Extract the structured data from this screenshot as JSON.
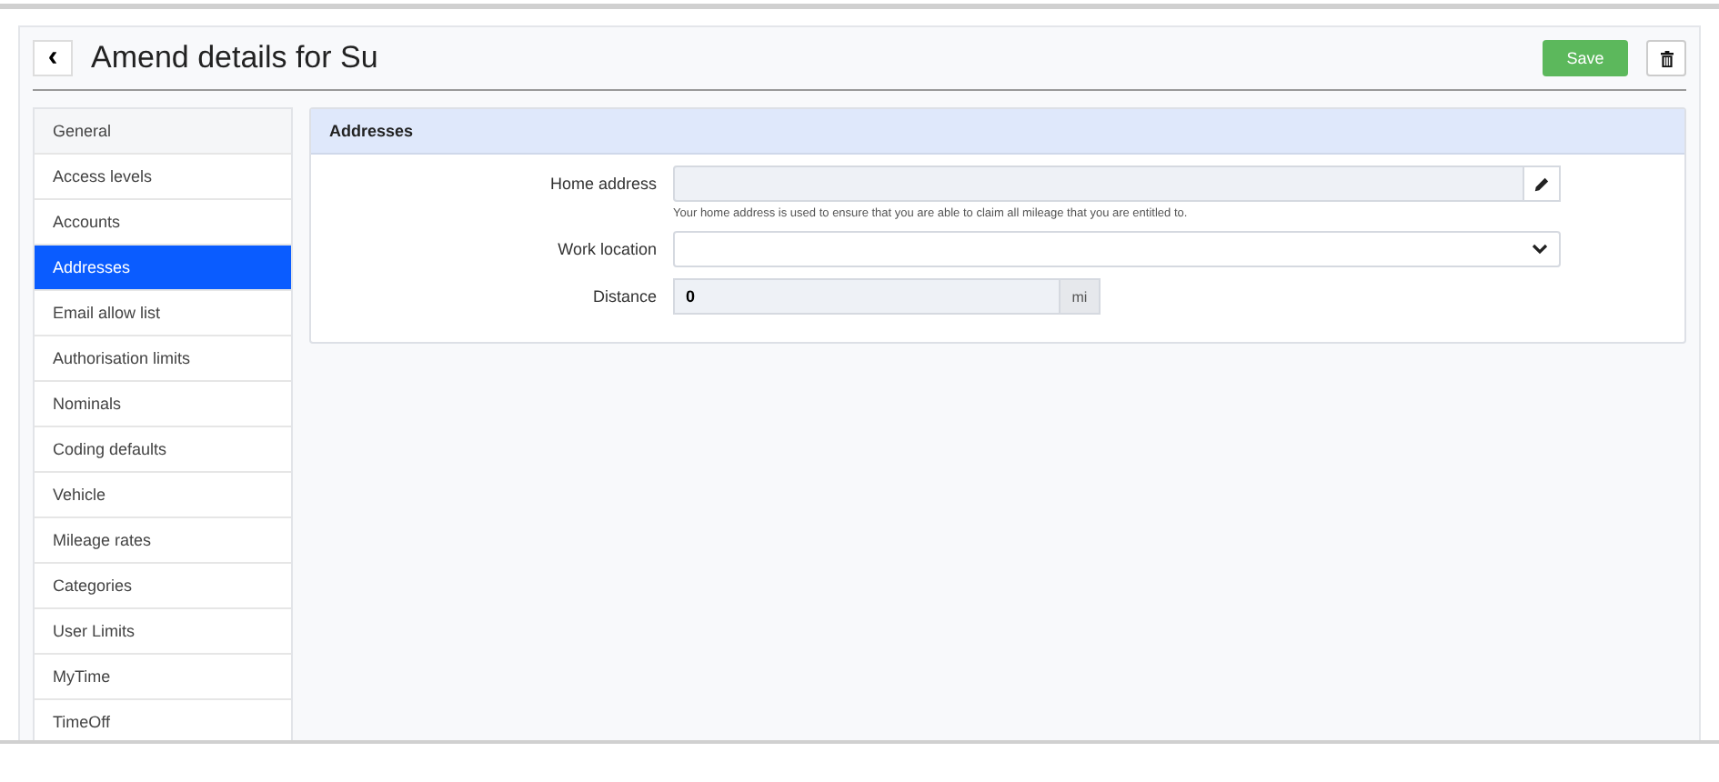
{
  "header": {
    "back_icon": "‹",
    "title": "Amend details for Su",
    "save_label": "Save"
  },
  "sidebar": {
    "items": [
      {
        "label": "General",
        "selected": false
      },
      {
        "label": "Access levels",
        "selected": false
      },
      {
        "label": "Accounts",
        "selected": false
      },
      {
        "label": "Addresses",
        "selected": true
      },
      {
        "label": "Email allow list",
        "selected": false
      },
      {
        "label": "Authorisation limits",
        "selected": false
      },
      {
        "label": "Nominals",
        "selected": false
      },
      {
        "label": "Coding defaults",
        "selected": false
      },
      {
        "label": "Vehicle",
        "selected": false
      },
      {
        "label": "Mileage rates",
        "selected": false
      },
      {
        "label": "Categories",
        "selected": false
      },
      {
        "label": "User Limits",
        "selected": false
      },
      {
        "label": "MyTime",
        "selected": false
      },
      {
        "label": "TimeOff",
        "selected": false
      }
    ]
  },
  "panel": {
    "title": "Addresses",
    "fields": [
      {
        "kind": "edit",
        "label": "Home address",
        "help": "Your home address is used to ensure that you are able to claim all mileage that you are entitled to."
      },
      {
        "kind": "select",
        "label": "Work location"
      },
      {
        "kind": "unit",
        "label": "Distance",
        "value": "0",
        "unit": "mi"
      }
    ]
  }
}
